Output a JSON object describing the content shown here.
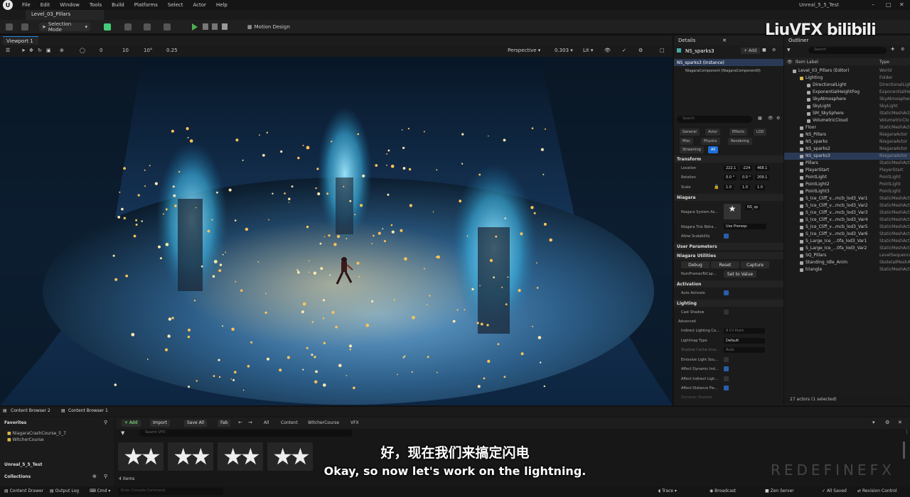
{
  "menu": {
    "items": [
      "File",
      "Edit",
      "Window",
      "Tools",
      "Build",
      "Platforms",
      "Select",
      "Actor",
      "Help"
    ],
    "title": "Unreal_5_5_Test"
  },
  "tabs": {
    "level": "Level_03_Pillars"
  },
  "toolbar": {
    "selection_mode": "Selection Mode",
    "motion_design": "Motion Design"
  },
  "viewport": {
    "tab": "Viewport 1",
    "snap_move": "10",
    "snap_rot": "10°",
    "snap_scale": "0.25",
    "grid_val": "0",
    "perspective": "Perspective",
    "speed": "0.303",
    "lit": "Lit"
  },
  "details": {
    "tab": "Details",
    "actor": "NS_sparks3",
    "add": "+ Add",
    "instance": "NS_sparks3 (Instance)",
    "component": "NiagaraComponent (NiagaraComponent0)",
    "search_placeholder": "Search",
    "categories": [
      "General",
      "Actor",
      "Effects",
      "LOD",
      "Misc",
      "Physics",
      "Rendering",
      "Streaming",
      "All"
    ],
    "sections": {
      "transform": "Transform",
      "niagara": "Niagara",
      "user_params": "User Parameters",
      "utilities": "Niagara Utilities",
      "activation": "Activation",
      "lighting": "Lighting",
      "advanced": "Advanced"
    },
    "location": {
      "label": "Location",
      "x": "222.1",
      "y": "-224",
      "z": "468.1"
    },
    "rotation": {
      "label": "Rotation",
      "x": "0.0 °",
      "y": "0.0 °",
      "z": "209.1"
    },
    "scale": {
      "label": "Scale",
      "x": "1.0",
      "y": "1.0",
      "z": "1.0"
    },
    "niagara_system_label": "Niagara System As...",
    "niagara_system_value": "NS_sp",
    "tick_label": "Niagara Tick Beha...",
    "tick_value": "Use Prereqs",
    "allow_scalability": "Allow Scalability",
    "debug": "Debug",
    "reset": "Reset",
    "capture": "Capture",
    "num_frames": "NumFramesToCap...",
    "set_value": "Set to Value",
    "auto_activate": "Auto Activate",
    "cast_shadow": "Cast Shadow",
    "indirect_label": "Indirect Lighting Ca...",
    "indirect_value": "8 Cll Point",
    "lightmap_label": "Lightmap Type",
    "lightmap_value": "Default",
    "shadow_cache_label": "Shadow Cache Inva...",
    "shadow_cache_value": "Auto",
    "emissive": "Emissive Light Sou...",
    "affect_dynamic": "Affect Dynamic Ind...",
    "affect_indirect": "Affect Indirect Ligh...",
    "affect_distance": "Affect Distance Fie...",
    "dynamic_shadow": "Dynamic Shadow"
  },
  "outliner": {
    "tab": "Outliner",
    "search_placeholder": "Search",
    "col_label": "Item Label",
    "col_type": "Type",
    "footer": "27 actors (1 selected)",
    "items": [
      {
        "label": "Level_03_Pillars (Editor)",
        "type": "World",
        "indent": 0
      },
      {
        "label": "Lighting",
        "type": "Folder",
        "indent": 1
      },
      {
        "label": "DirectionalLight",
        "type": "DirectionalLight",
        "indent": 2
      },
      {
        "label": "ExponentialHeightFog",
        "type": "ExponentialHe",
        "indent": 2
      },
      {
        "label": "SkyAtmosphere",
        "type": "SkyAtmosphere",
        "indent": 2
      },
      {
        "label": "SkyLight",
        "type": "SkyLight",
        "indent": 2
      },
      {
        "label": "SM_SkySphere",
        "type": "StaticMeshAct",
        "indent": 2
      },
      {
        "label": "VolumetricCloud",
        "type": "VolumetricClo",
        "indent": 2
      },
      {
        "label": "Floor",
        "type": "StaticMeshAct",
        "indent": 1
      },
      {
        "label": "NS_Pillars",
        "type": "NiagaraActor",
        "indent": 1
      },
      {
        "label": "NS_sparks",
        "type": "NiagaraActor",
        "indent": 1
      },
      {
        "label": "NS_sparks2",
        "type": "NiagaraActor",
        "indent": 1
      },
      {
        "label": "NS_sparks3",
        "type": "NiagaraActor",
        "indent": 1,
        "selected": true
      },
      {
        "label": "Pillars",
        "type": "StaticMeshAct",
        "indent": 1
      },
      {
        "label": "PlayerStart",
        "type": "PlayerStart",
        "indent": 1
      },
      {
        "label": "PointLight",
        "type": "PointLight",
        "indent": 1
      },
      {
        "label": "PointLight2",
        "type": "PointLight",
        "indent": 1
      },
      {
        "label": "PointLight3",
        "type": "PointLight",
        "indent": 1
      },
      {
        "label": "S_Ice_Cliff_v...mcb_lod3_Var1",
        "type": "StaticMeshAct",
        "indent": 1
      },
      {
        "label": "S_Ice_Cliff_v...mcb_lod3_Var2",
        "type": "StaticMeshAct",
        "indent": 1
      },
      {
        "label": "S_Ice_Cliff_v...mcb_lod3_Var3",
        "type": "StaticMeshAct",
        "indent": 1
      },
      {
        "label": "S_Ice_Cliff_v...mcb_lod3_Var4",
        "type": "StaticMeshAct",
        "indent": 1
      },
      {
        "label": "S_Ice_Cliff_v...mcb_lod3_Var5",
        "type": "StaticMeshAct",
        "indent": 1
      },
      {
        "label": "S_Ice_Cliff_v...mcb_lod3_Var6",
        "type": "StaticMeshAct",
        "indent": 1
      },
      {
        "label": "S_Large_Ice_...0fa_lod3_Var1",
        "type": "StaticMeshAct",
        "indent": 1
      },
      {
        "label": "S_Large_Ice_...0fa_lod3_Var2",
        "type": "StaticMeshAct",
        "indent": 1
      },
      {
        "label": "SQ_Pillars",
        "type": "LevelSequence",
        "indent": 1
      },
      {
        "label": "Standing_Idle_Anim",
        "type": "SkeletalMeshA",
        "indent": 1
      },
      {
        "label": "triangle",
        "type": "StaticMeshAct",
        "indent": 1
      }
    ]
  },
  "content_browser": {
    "tabs": [
      "Content Browser 2",
      "Content Browser 1"
    ],
    "favorites": "Favorites",
    "fav_items": [
      "NiagaraCrashCourse_5_7",
      "WitcherCourse"
    ],
    "project": "Unreal_5_5_Test",
    "collections": "Collections",
    "add": "+ Add",
    "import": "Import",
    "save_all": "Save All",
    "fab": "Fab",
    "path": [
      "All",
      "Content",
      "WitcherCourse",
      "VFX"
    ],
    "search_placeholder": "Search VFX",
    "item_count": "4 items"
  },
  "subtitle": {
    "zh": "好，现在我们来搞定闪电",
    "en": "Okay, so now let's work on the lightning."
  },
  "statusbar": {
    "content_drawer": "Content Drawer",
    "output_log": "Output Log",
    "cmd": "Cmd",
    "console_placeholder": "Enter Console Command",
    "trace": "Trace",
    "broadcast": "Broadcast",
    "zen": "Zen Server",
    "saved": "All Saved",
    "revision": "Revision Control"
  },
  "overlay": {
    "watermark": "LiuVFX bilibili",
    "redefine": "REDEFINEFX"
  },
  "colors": {
    "accent": "#1e6fd9",
    "play": "#4caf50",
    "selection": "#2a3a56"
  }
}
